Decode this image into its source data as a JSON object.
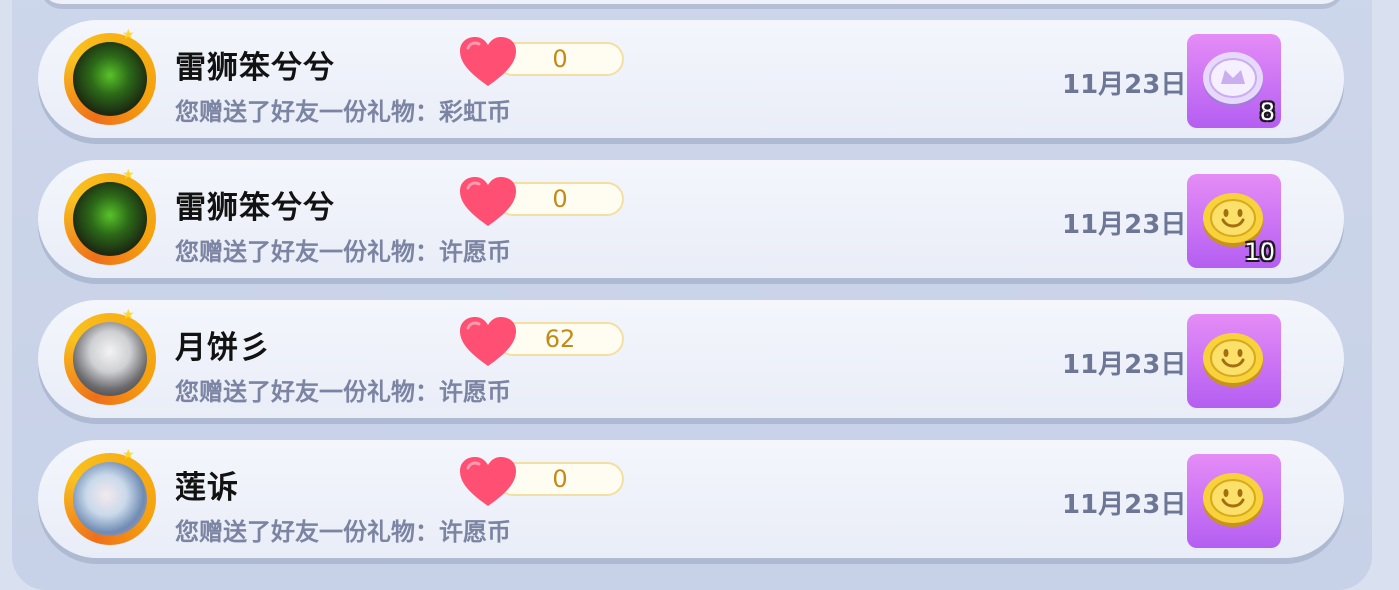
{
  "colors": {
    "panel": "#c9d3e9",
    "row": "#eef1f9",
    "name": "#121212",
    "desc": "#7b84a2",
    "count": "#c48a17",
    "heart": "#ff4f72",
    "gift_bg": "#c86ef4"
  },
  "rows": [
    {
      "name": "雷狮笨兮兮",
      "desc": "您赠送了好友一份礼物：彩虹币",
      "likes": "0",
      "date": "11月23日",
      "gift_icon": "rainbow-coin-icon",
      "gift_qty": "8"
    },
    {
      "name": "雷狮笨兮兮",
      "desc": "您赠送了好友一份礼物：许愿币",
      "likes": "0",
      "date": "11月23日",
      "gift_icon": "wish-coin-icon",
      "gift_qty": "10"
    },
    {
      "name": "月饼彡",
      "desc": "您赠送了好友一份礼物：许愿币",
      "likes": "62",
      "date": "11月23日",
      "gift_icon": "wish-coin-icon",
      "gift_qty": ""
    },
    {
      "name": "莲诉",
      "desc": "您赠送了好友一份礼物：许愿币",
      "likes": "0",
      "date": "11月23日",
      "gift_icon": "wish-coin-icon",
      "gift_qty": ""
    }
  ]
}
